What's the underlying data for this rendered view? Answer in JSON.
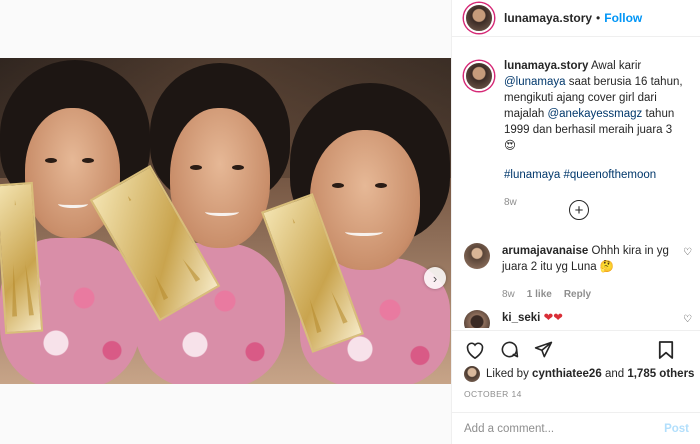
{
  "post": {
    "username": "lunamaya.story",
    "follow_label": "Follow",
    "dot": "•",
    "photo_alt": "Three young women holding trophies",
    "next_icon": "chevron-right-icon"
  },
  "caption": {
    "username": "lunamaya.story",
    "text_1": "Awal karir",
    "mention_1": "@lunamaya",
    "text_2": "saat berusia 16 tahun, mengikuti ajang cover girl dari majalah",
    "mention_2": "@anekayessmagz",
    "text_3": "tahun 1999 dan berhasil meraih juara 3 😍",
    "hashtags": "#lunamaya #queenofthemoon",
    "time": "8w"
  },
  "load_more_icon": "plus-circle-icon",
  "comments": [
    {
      "username": "arumajavanaise",
      "text": "Ohhh kira in yg juara 2 itu yg Luna 🤔",
      "age": "8w",
      "likes": "1 like",
      "reply": "Reply"
    },
    {
      "username": "ki_seki",
      "text": "❤❤"
    }
  ],
  "actions": {
    "like_icon": "heart-icon",
    "comment_icon": "comment-icon",
    "share_icon": "share-icon",
    "save_icon": "bookmark-icon"
  },
  "likes": {
    "prefix": "Liked by",
    "user": "cynthiatee26",
    "and": "and",
    "others": "1,785 others"
  },
  "date": "OCTOBER 14",
  "add_comment": {
    "placeholder": "Add a comment...",
    "post_label": "Post"
  },
  "colors": {
    "link": "#00376b",
    "follow": "#0095f6",
    "post_disabled": "#b2dffc",
    "heart_red": "#d92e37"
  }
}
